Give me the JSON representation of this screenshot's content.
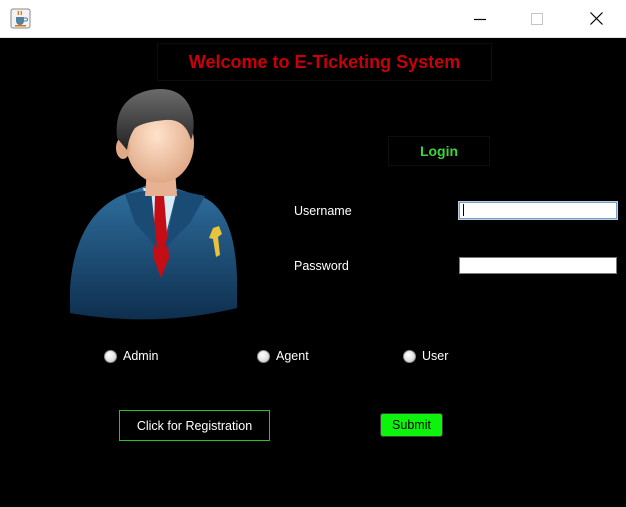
{
  "window": {
    "icon": "java-coffee-icon",
    "controls": [
      "minimize-icon",
      "maximize-icon",
      "close-icon"
    ]
  },
  "header": {
    "title": "Welcome to E-Ticketing System"
  },
  "login": {
    "title": "Login",
    "username_label": "Username",
    "username_value": "",
    "password_label": "Password",
    "password_value": ""
  },
  "roles": [
    {
      "label": "Admin",
      "selected": false
    },
    {
      "label": "Agent",
      "selected": false
    },
    {
      "label": "User",
      "selected": false
    }
  ],
  "actions": {
    "registration_label": "Click for Registration",
    "submit_label": "Submit"
  },
  "colors": {
    "background": "#000000",
    "heading": "#c8000a",
    "login_title": "#3ed43e",
    "submit_bg": "#0cf30c",
    "registration_border": "#27c427"
  }
}
